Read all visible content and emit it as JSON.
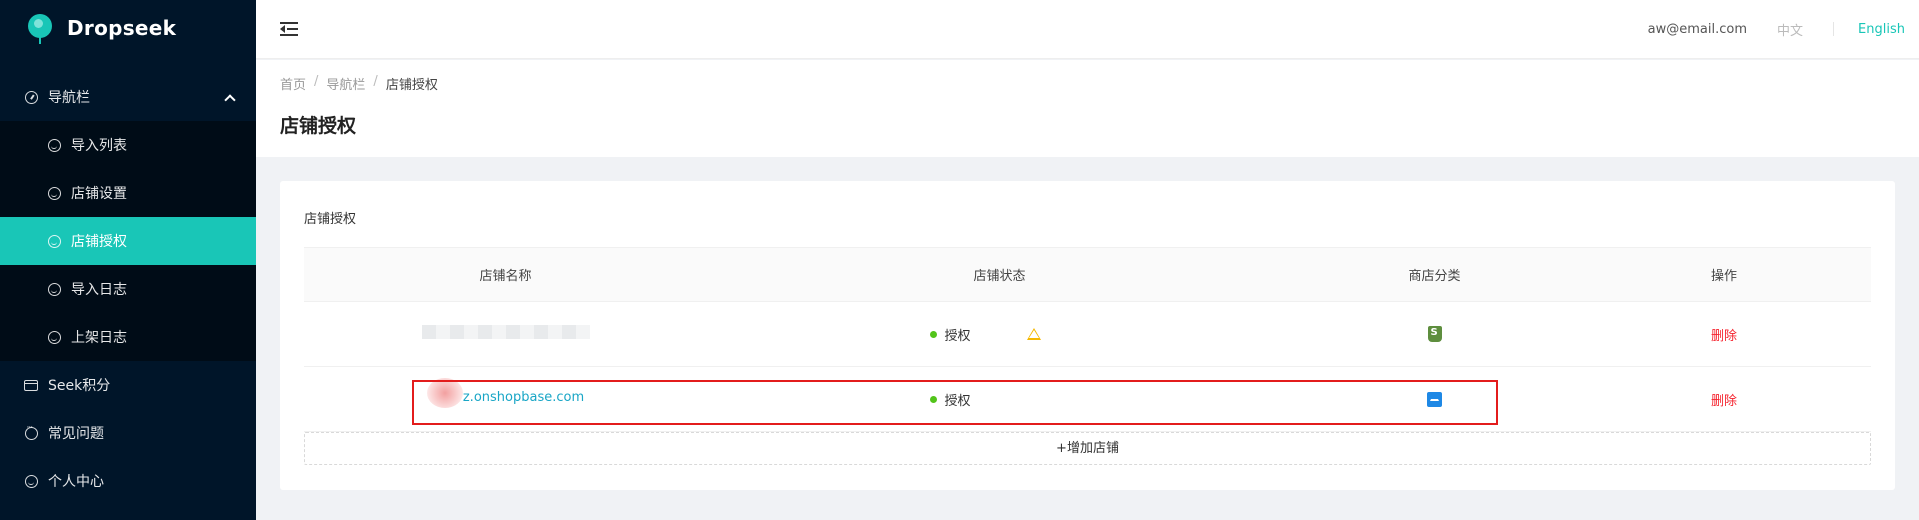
{
  "app": {
    "name": "Dropseek"
  },
  "sidebar": {
    "group_label": "导航栏",
    "sub_items": [
      {
        "label": "导入列表",
        "active": false
      },
      {
        "label": "店铺设置",
        "active": false
      },
      {
        "label": "店铺授权",
        "active": true
      },
      {
        "label": "导入日志",
        "active": false
      },
      {
        "label": "上架日志",
        "active": false
      }
    ],
    "items": [
      {
        "label": "Seek积分",
        "icon": "card-icon"
      },
      {
        "label": "常见问题",
        "icon": "chat-icon"
      },
      {
        "label": "个人中心",
        "icon": "user-smile-icon"
      }
    ]
  },
  "header": {
    "user_email": "aw@email.com",
    "lang_zh": "中文",
    "lang_en": "English"
  },
  "breadcrumb": [
    "首页",
    "导航栏",
    "店铺授权"
  ],
  "page": {
    "title": "店铺授权"
  },
  "card": {
    "title": "店铺授权",
    "columns": [
      "店铺名称",
      "店铺状态",
      "商店分类",
      "操作"
    ],
    "rows": [
      {
        "store_name": "",
        "status": "授权",
        "has_warning": true,
        "category_icon": "shopify-icon",
        "action": "删除"
      },
      {
        "store_name": "z.onshopbase.com",
        "status": "授权",
        "has_warning": false,
        "category_icon": "shopbase-icon",
        "action": "删除"
      }
    ],
    "add_button": "+增加店铺"
  },
  "colors": {
    "accent": "#19c6b7",
    "sidebar_bg": "#001529",
    "danger": "#f5222d",
    "success": "#52c41a",
    "highlight": "#e31c1c"
  }
}
